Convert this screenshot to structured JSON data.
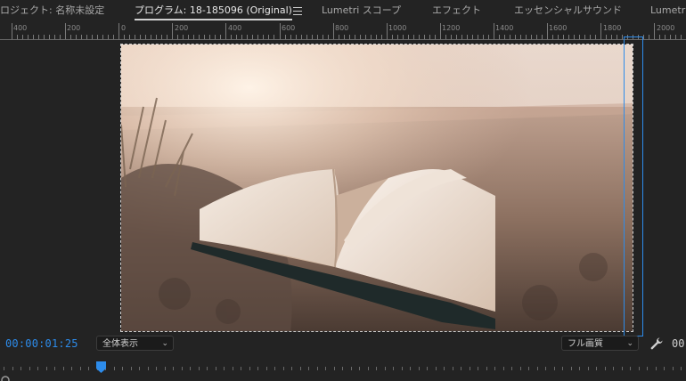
{
  "tabs": [
    {
      "label": "ロジェクト: 名称未設定"
    },
    {
      "label": "プログラム: 18-185096 (Original)"
    },
    {
      "label": "Lumetri スコープ"
    },
    {
      "label": "エフェクト"
    },
    {
      "label": "エッセンシャルサウンド"
    },
    {
      "label": "Lumetri"
    }
  ],
  "ruler": {
    "labels": [
      "400",
      "200",
      "0",
      "200",
      "400",
      "600",
      "800",
      "1000",
      "1200",
      "1400",
      "1600",
      "1800",
      "2000"
    ]
  },
  "controls": {
    "playhead_timecode": "00:00:01:25",
    "zoom_select": "全体表示",
    "quality_select": "フル画質",
    "duration_timecode": "00"
  },
  "icons": {
    "menu": "hamburger-menu-icon",
    "wrench": "wrench-icon",
    "playhead": "playhead-marker-icon"
  },
  "colors": {
    "accent": "#2d8ceb",
    "background": "#232323",
    "active_tab_text": "#e6e6e6"
  }
}
